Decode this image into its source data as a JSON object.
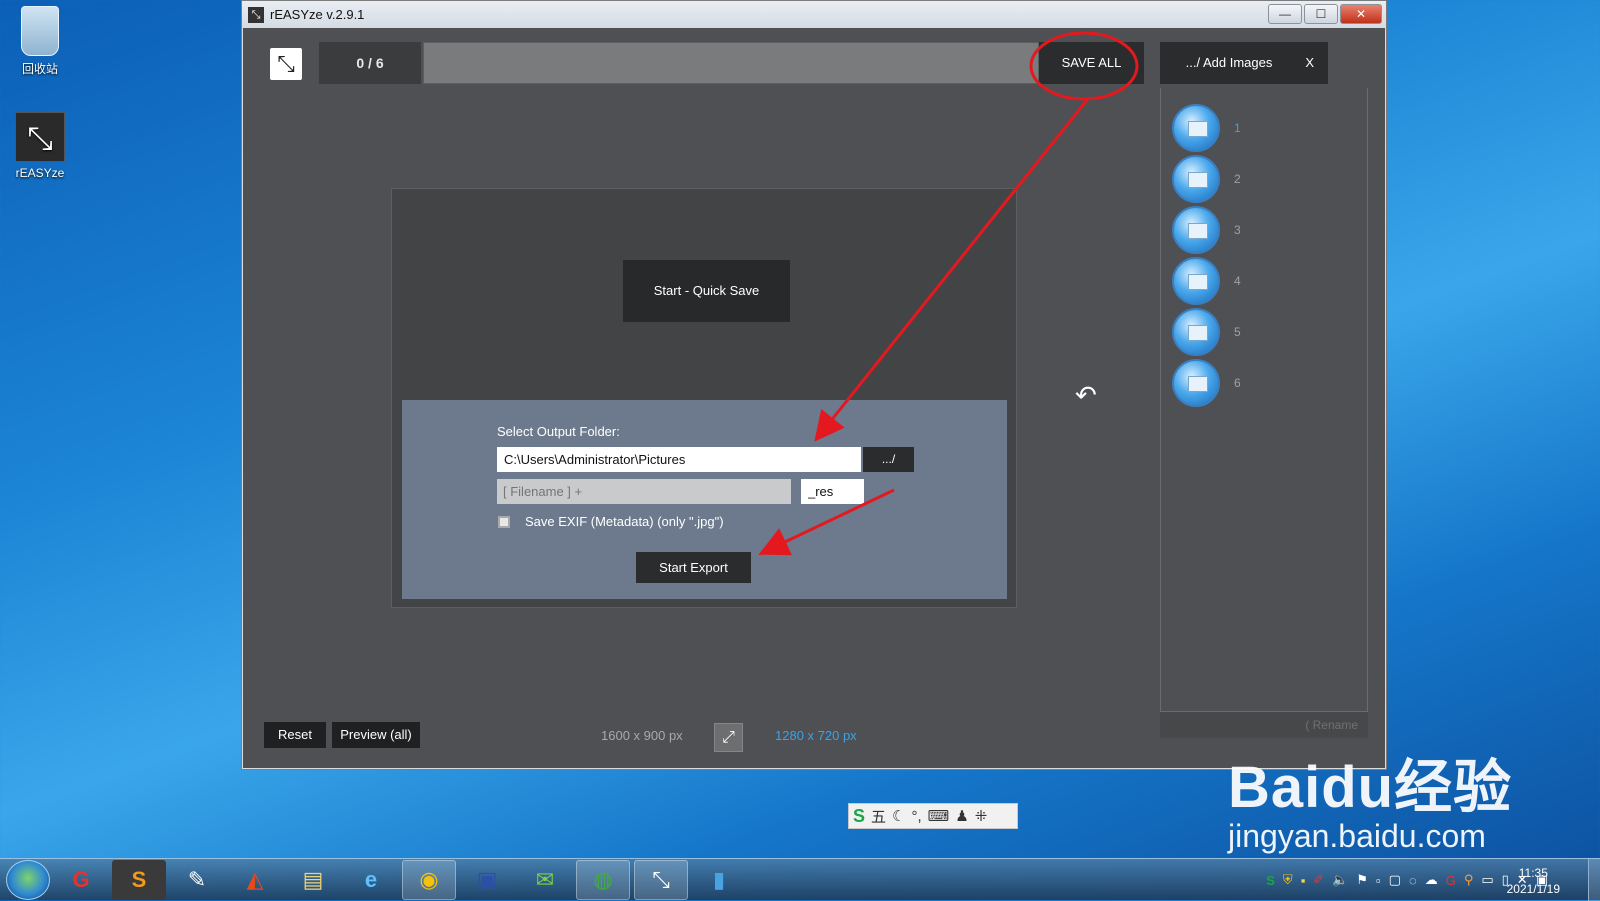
{
  "desktop": {
    "icons": [
      {
        "label": "回收站",
        "icon": "recycle-bin-icon"
      },
      {
        "label": "rEASYze",
        "icon": "reasyze-app-icon"
      }
    ]
  },
  "window": {
    "title": "rEASYze v.2.9.1",
    "controls": {
      "minimize": "—",
      "maximize": "☐",
      "close": "✕"
    }
  },
  "toolbar": {
    "counter": "0 / 6",
    "progress": 0,
    "save_all": "SAVE ALL",
    "add_images": ".../ Add Images",
    "close_list": "X"
  },
  "images": [
    {
      "number": "1",
      "active": true
    },
    {
      "number": "2",
      "active": false
    },
    {
      "number": "3",
      "active": false
    },
    {
      "number": "4",
      "active": false
    },
    {
      "number": "5",
      "active": false
    },
    {
      "number": "6",
      "active": false
    }
  ],
  "rename_placeholder": "( Rename",
  "dialog": {
    "quick_save": "Start - Quick Save",
    "select_output_label": "Select Output Folder:",
    "output_folder": "C:\\Users\\Administrator\\Pictures",
    "browse": ".../",
    "filename_placeholder": "[ Filename ] +",
    "suffix": "_res",
    "exif_label": "Save EXIF (Metadata) (only \".jpg\")",
    "exif_checked": false,
    "start_export": "Start Export"
  },
  "bottom": {
    "reset": "Reset",
    "preview": "Preview (all)",
    "source_size": "1600 x 900 px",
    "target_size": "1280 x 720 px"
  },
  "ime": {
    "brand": "S",
    "mode": "五"
  },
  "watermark": {
    "line1": "Baidu经验",
    "line2": "jingyan.baidu.com"
  },
  "taskbar": {
    "apps": [
      "start-orb",
      "browser-g-icon",
      "sublime-text-icon",
      "notepad-icon",
      "office-icon",
      "file-explorer-icon",
      "internet-explorer-icon",
      "chrome-icon",
      "floppy-save-icon",
      "wechat-icon",
      "globe-icon",
      "reasyze-app-icon",
      "editor-icon"
    ],
    "clock_time": "11:35",
    "clock_date": "2021/1/19"
  },
  "colors": {
    "app_bg": "#4f5053",
    "accent_blue": "#39a3e8",
    "export_panel": "#6d7a8d",
    "annotation_red": "#e3191f"
  }
}
